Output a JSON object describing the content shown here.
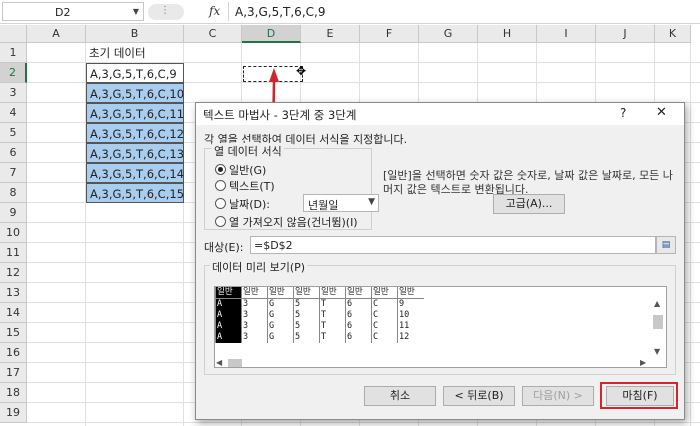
{
  "formula_bar": {
    "name_box": "D2",
    "name_box_arrow": "▼",
    "separator_glyph": "⋮",
    "fx_label": "fx",
    "formula": "A,3,G,5,T,6,C,9"
  },
  "grid": {
    "columns": [
      "A",
      "B",
      "C",
      "D",
      "E",
      "F",
      "G",
      "H",
      "I",
      "J",
      "K"
    ],
    "rows": [
      "1",
      "2",
      "3",
      "4",
      "5",
      "6",
      "7",
      "8",
      "9",
      "10",
      "11",
      "12",
      "13",
      "14",
      "15",
      "16",
      "17",
      "18",
      "19"
    ],
    "active_column": "D",
    "active_row": "2",
    "b_cells": [
      "초기 데이터",
      "A,3,G,5,T,6,C,9",
      "A,3,G,5,T,6,C,10",
      "A,3,G,5,T,6,C,11",
      "A,3,G,5,T,6,C,12",
      "A,3,G,5,T,6,C,13",
      "A,3,G,5,T,6,C,14",
      "A,3,G,5,T,6,C,15"
    ],
    "cursor_glyph": "✥",
    "colors": {
      "highlight": "#a9cdef",
      "accent_green": "#217346",
      "arrow_red": "#d0262e"
    }
  },
  "dialog": {
    "title": "텍스트 마법사 - 3단계 중 3단계",
    "help": "?",
    "close": "✕",
    "instruction": "각 열을 선택하여 데이터 서식을 지정합니다.",
    "format_legend": "열 데이터 서식",
    "radios": [
      "일반(G)",
      "텍스트(T)",
      "날짜(D):",
      "열 가져오지 않음(건너뜀)(I)"
    ],
    "selected_radio": 0,
    "date_select": "년월일",
    "date_select_arrow": "▼",
    "description": "[일반]을 선택하면 숫자 값은 숫자로, 날짜 값은 날짜로, 모든 나머지 값은 텍스트로 변환됩니다.",
    "advanced_button": "고급(A)...",
    "destination_label": "대상(E):",
    "destination_value": "=$D$2",
    "destination_button_icon": "▤",
    "preview_label": "데이터 미리 보기(P)",
    "preview_header": [
      "일반",
      "일반",
      "일반",
      "일반",
      "일반",
      "일반",
      "일반",
      "일반"
    ],
    "preview_rows": [
      [
        "A",
        "3",
        "G",
        "5",
        "T",
        "6",
        "C",
        "9"
      ],
      [
        "A",
        "3",
        "G",
        "5",
        "T",
        "6",
        "C",
        "10"
      ],
      [
        "A",
        "3",
        "G",
        "5",
        "T",
        "6",
        "C",
        "11"
      ],
      [
        "A",
        "3",
        "G",
        "5",
        "T",
        "6",
        "C",
        "12"
      ]
    ],
    "scroll_up": "▲",
    "scroll_down": "▼",
    "scroll_left": "◀",
    "scroll_right": "▶",
    "buttons": {
      "cancel": "취소",
      "back": "< 뒤로(B)",
      "next": "다음(N) >",
      "finish": "마침(F)"
    }
  }
}
